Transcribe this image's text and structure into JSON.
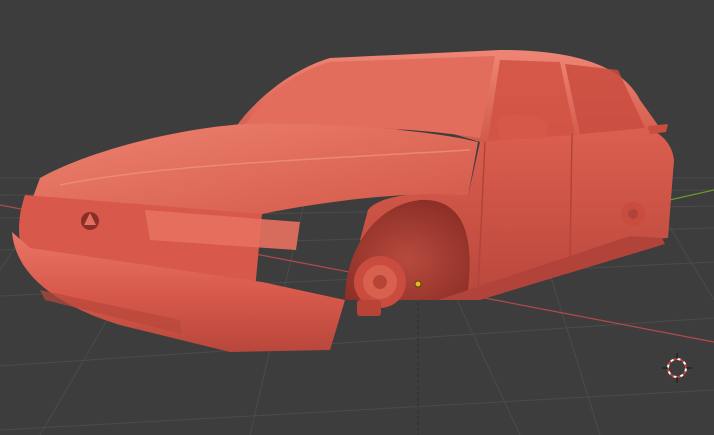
{
  "app": {
    "name": "3D viewport",
    "view": "perspective"
  },
  "colors": {
    "background": "#3d3d3d",
    "grid_line": "#4b4b4b",
    "x_axis": "#b34a4a",
    "y_axis": "#6a9a2a",
    "model_base": "#d85a4c",
    "model_highlight": "#ec7a66",
    "model_shadow": "#a93c33",
    "origin_dot": "#e6b820"
  },
  "scene": {
    "object": "car-body-mesh",
    "material": "clay-red",
    "wheels_present": false,
    "brake_assemblies_visible": 2
  },
  "icons": {
    "cursor": "3d-cursor-icon",
    "origin": "object-origin-icon"
  }
}
